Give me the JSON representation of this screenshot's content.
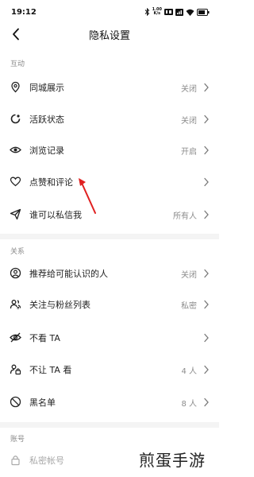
{
  "status_bar": {
    "time": "19:12",
    "net_speed_value": "1.00",
    "net_speed_unit": "K/s",
    "icons": [
      "bluetooth-icon",
      "hd-icon",
      "signal-icon",
      "wifi-icon",
      "battery-icon"
    ]
  },
  "nav": {
    "title": "隐私设置",
    "back_icon": "chevron-left-icon"
  },
  "sections": {
    "interaction": {
      "label": "互动",
      "items": [
        {
          "icon": "location-pin-icon",
          "label": "同城展示",
          "value": "关闭"
        },
        {
          "icon": "activity-status-icon",
          "label": "活跃状态",
          "value": "关闭"
        },
        {
          "icon": "eye-icon",
          "label": "浏览记录",
          "value": "开启"
        },
        {
          "icon": "heart-icon",
          "label": "点赞和评论",
          "value": ""
        },
        {
          "icon": "send-icon",
          "label": "谁可以私信我",
          "value": "所有人"
        }
      ]
    },
    "relation": {
      "label": "关系",
      "items": [
        {
          "icon": "user-circle-icon",
          "label": "推荐给可能认识的人",
          "value": "关闭"
        },
        {
          "icon": "users-icon",
          "label": "关注与粉丝列表",
          "value": "私密"
        },
        {
          "icon": "eye-off-icon",
          "label": "不看 TA",
          "value": ""
        },
        {
          "icon": "user-lock-icon",
          "label": "不让 TA 看",
          "value": "4 人"
        },
        {
          "icon": "block-icon",
          "label": "黑名单",
          "value": "8 人"
        }
      ]
    },
    "account": {
      "label": "账号",
      "items": [
        {
          "icon": "lock-icon",
          "label": "私密帐号",
          "value": ""
        }
      ]
    }
  },
  "watermark": "煎蛋手游",
  "colors": {
    "background": "#ffffff",
    "divider": "#f4f4f4",
    "section_label": "#8a8a8a",
    "value_text": "#8c8c8c",
    "annotation_arrow": "#e02020"
  }
}
